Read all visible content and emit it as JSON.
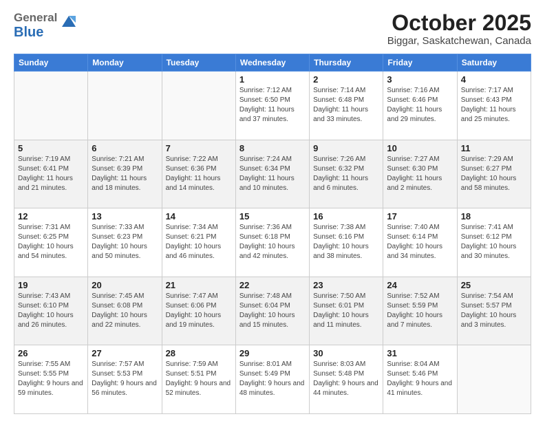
{
  "header": {
    "logo_general": "General",
    "logo_blue": "Blue",
    "month": "October 2025",
    "location": "Biggar, Saskatchewan, Canada"
  },
  "days_of_week": [
    "Sunday",
    "Monday",
    "Tuesday",
    "Wednesday",
    "Thursday",
    "Friday",
    "Saturday"
  ],
  "weeks": [
    [
      {
        "day": "",
        "sunrise": "",
        "sunset": "",
        "daylight": ""
      },
      {
        "day": "",
        "sunrise": "",
        "sunset": "",
        "daylight": ""
      },
      {
        "day": "",
        "sunrise": "",
        "sunset": "",
        "daylight": ""
      },
      {
        "day": "1",
        "sunrise": "Sunrise: 7:12 AM",
        "sunset": "Sunset: 6:50 PM",
        "daylight": "Daylight: 11 hours and 37 minutes."
      },
      {
        "day": "2",
        "sunrise": "Sunrise: 7:14 AM",
        "sunset": "Sunset: 6:48 PM",
        "daylight": "Daylight: 11 hours and 33 minutes."
      },
      {
        "day": "3",
        "sunrise": "Sunrise: 7:16 AM",
        "sunset": "Sunset: 6:46 PM",
        "daylight": "Daylight: 11 hours and 29 minutes."
      },
      {
        "day": "4",
        "sunrise": "Sunrise: 7:17 AM",
        "sunset": "Sunset: 6:43 PM",
        "daylight": "Daylight: 11 hours and 25 minutes."
      }
    ],
    [
      {
        "day": "5",
        "sunrise": "Sunrise: 7:19 AM",
        "sunset": "Sunset: 6:41 PM",
        "daylight": "Daylight: 11 hours and 21 minutes."
      },
      {
        "day": "6",
        "sunrise": "Sunrise: 7:21 AM",
        "sunset": "Sunset: 6:39 PM",
        "daylight": "Daylight: 11 hours and 18 minutes."
      },
      {
        "day": "7",
        "sunrise": "Sunrise: 7:22 AM",
        "sunset": "Sunset: 6:36 PM",
        "daylight": "Daylight: 11 hours and 14 minutes."
      },
      {
        "day": "8",
        "sunrise": "Sunrise: 7:24 AM",
        "sunset": "Sunset: 6:34 PM",
        "daylight": "Daylight: 11 hours and 10 minutes."
      },
      {
        "day": "9",
        "sunrise": "Sunrise: 7:26 AM",
        "sunset": "Sunset: 6:32 PM",
        "daylight": "Daylight: 11 hours and 6 minutes."
      },
      {
        "day": "10",
        "sunrise": "Sunrise: 7:27 AM",
        "sunset": "Sunset: 6:30 PM",
        "daylight": "Daylight: 11 hours and 2 minutes."
      },
      {
        "day": "11",
        "sunrise": "Sunrise: 7:29 AM",
        "sunset": "Sunset: 6:27 PM",
        "daylight": "Daylight: 10 hours and 58 minutes."
      }
    ],
    [
      {
        "day": "12",
        "sunrise": "Sunrise: 7:31 AM",
        "sunset": "Sunset: 6:25 PM",
        "daylight": "Daylight: 10 hours and 54 minutes."
      },
      {
        "day": "13",
        "sunrise": "Sunrise: 7:33 AM",
        "sunset": "Sunset: 6:23 PM",
        "daylight": "Daylight: 10 hours and 50 minutes."
      },
      {
        "day": "14",
        "sunrise": "Sunrise: 7:34 AM",
        "sunset": "Sunset: 6:21 PM",
        "daylight": "Daylight: 10 hours and 46 minutes."
      },
      {
        "day": "15",
        "sunrise": "Sunrise: 7:36 AM",
        "sunset": "Sunset: 6:18 PM",
        "daylight": "Daylight: 10 hours and 42 minutes."
      },
      {
        "day": "16",
        "sunrise": "Sunrise: 7:38 AM",
        "sunset": "Sunset: 6:16 PM",
        "daylight": "Daylight: 10 hours and 38 minutes."
      },
      {
        "day": "17",
        "sunrise": "Sunrise: 7:40 AM",
        "sunset": "Sunset: 6:14 PM",
        "daylight": "Daylight: 10 hours and 34 minutes."
      },
      {
        "day": "18",
        "sunrise": "Sunrise: 7:41 AM",
        "sunset": "Sunset: 6:12 PM",
        "daylight": "Daylight: 10 hours and 30 minutes."
      }
    ],
    [
      {
        "day": "19",
        "sunrise": "Sunrise: 7:43 AM",
        "sunset": "Sunset: 6:10 PM",
        "daylight": "Daylight: 10 hours and 26 minutes."
      },
      {
        "day": "20",
        "sunrise": "Sunrise: 7:45 AM",
        "sunset": "Sunset: 6:08 PM",
        "daylight": "Daylight: 10 hours and 22 minutes."
      },
      {
        "day": "21",
        "sunrise": "Sunrise: 7:47 AM",
        "sunset": "Sunset: 6:06 PM",
        "daylight": "Daylight: 10 hours and 19 minutes."
      },
      {
        "day": "22",
        "sunrise": "Sunrise: 7:48 AM",
        "sunset": "Sunset: 6:04 PM",
        "daylight": "Daylight: 10 hours and 15 minutes."
      },
      {
        "day": "23",
        "sunrise": "Sunrise: 7:50 AM",
        "sunset": "Sunset: 6:01 PM",
        "daylight": "Daylight: 10 hours and 11 minutes."
      },
      {
        "day": "24",
        "sunrise": "Sunrise: 7:52 AM",
        "sunset": "Sunset: 5:59 PM",
        "daylight": "Daylight: 10 hours and 7 minutes."
      },
      {
        "day": "25",
        "sunrise": "Sunrise: 7:54 AM",
        "sunset": "Sunset: 5:57 PM",
        "daylight": "Daylight: 10 hours and 3 minutes."
      }
    ],
    [
      {
        "day": "26",
        "sunrise": "Sunrise: 7:55 AM",
        "sunset": "Sunset: 5:55 PM",
        "daylight": "Daylight: 9 hours and 59 minutes."
      },
      {
        "day": "27",
        "sunrise": "Sunrise: 7:57 AM",
        "sunset": "Sunset: 5:53 PM",
        "daylight": "Daylight: 9 hours and 56 minutes."
      },
      {
        "day": "28",
        "sunrise": "Sunrise: 7:59 AM",
        "sunset": "Sunset: 5:51 PM",
        "daylight": "Daylight: 9 hours and 52 minutes."
      },
      {
        "day": "29",
        "sunrise": "Sunrise: 8:01 AM",
        "sunset": "Sunset: 5:49 PM",
        "daylight": "Daylight: 9 hours and 48 minutes."
      },
      {
        "day": "30",
        "sunrise": "Sunrise: 8:03 AM",
        "sunset": "Sunset: 5:48 PM",
        "daylight": "Daylight: 9 hours and 44 minutes."
      },
      {
        "day": "31",
        "sunrise": "Sunrise: 8:04 AM",
        "sunset": "Sunset: 5:46 PM",
        "daylight": "Daylight: 9 hours and 41 minutes."
      },
      {
        "day": "",
        "sunrise": "",
        "sunset": "",
        "daylight": ""
      }
    ]
  ]
}
